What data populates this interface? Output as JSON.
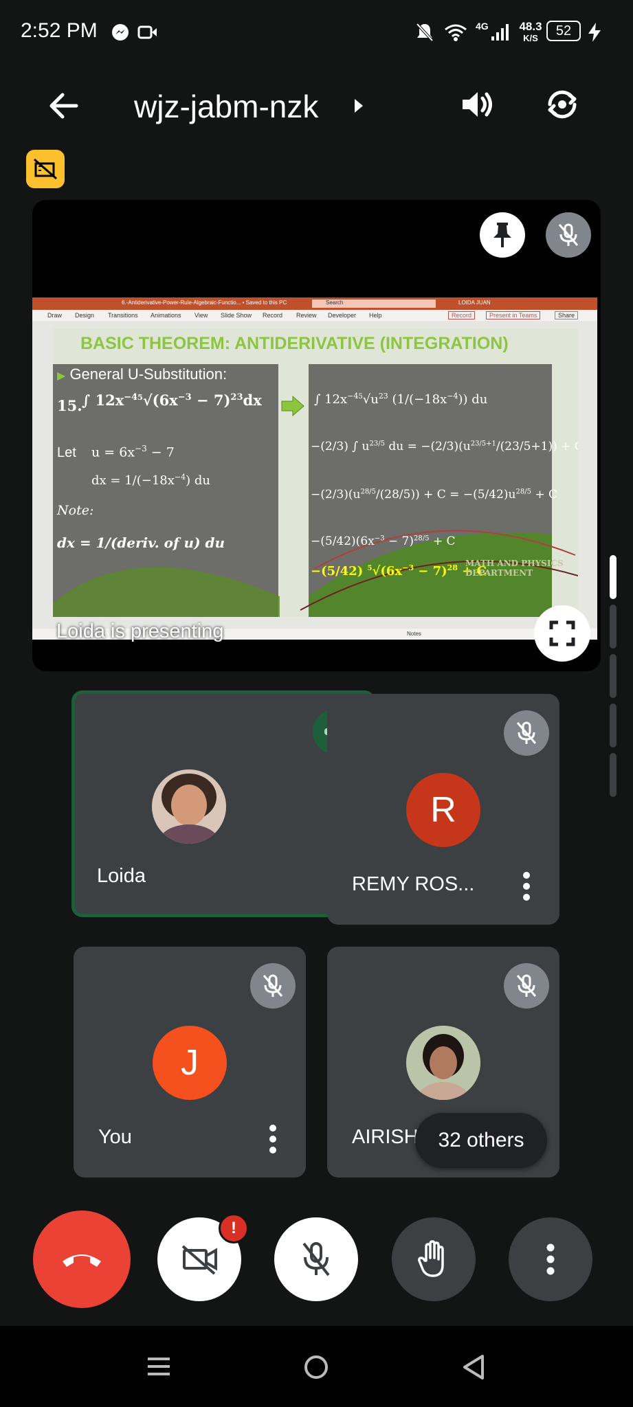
{
  "status_bar": {
    "time": "2:52 PM",
    "network": "4G",
    "speed_value": "48.3",
    "speed_unit": "K/S",
    "battery": "52"
  },
  "header": {
    "meeting_code": "wjz-jabm-nzk"
  },
  "presentation": {
    "presenting_label": "Loida is presenting",
    "ppt_filename": "6.-Antiderivative-Power-Rule-Algebraic-Functio... • Saved to this PC",
    "ppt_search": "Search",
    "ppt_user": "LOIDA JUAN",
    "ppt_tabs": [
      "Draw",
      "Design",
      "Transitions",
      "Animations",
      "View",
      "Slide Show",
      "Record",
      "Review",
      "Developer",
      "Help"
    ],
    "ppt_buttons": [
      "Record",
      "Present in Teams",
      "Share"
    ],
    "ppt_notes": "Notes",
    "slide_title": "BASIC THEOREM: ANTIDERIVATIVE (INTEGRATION)",
    "slide_subtitle": "General U-Substitution:",
    "item_number": "15.",
    "let_label": "Let",
    "note_label": "Note:",
    "watermark_line1": "MATH AND PHYSICS",
    "watermark_line2": "DEPARTMENT"
  },
  "participants": [
    {
      "name": "Loida",
      "initial": "",
      "avatar_color": "",
      "speaking": true,
      "muted": false
    },
    {
      "name": "REMY ROS...",
      "initial": "R",
      "avatar_color": "#c5361b",
      "speaking": false,
      "muted": true
    },
    {
      "name": "You",
      "initial": "J",
      "avatar_color": "#f4511e",
      "speaking": false,
      "muted": true
    },
    {
      "name": "AIRISH A...",
      "initial": "",
      "avatar_color": "",
      "speaking": false,
      "muted": true
    }
  ],
  "others_label": "32 others",
  "controls": {
    "camera_alert": "!"
  },
  "colors": {
    "end_call": "#ea4335",
    "speaking_border": "#1e5e3b",
    "tile_bg": "#3c4043",
    "slide_title_color": "#8cc63f"
  }
}
